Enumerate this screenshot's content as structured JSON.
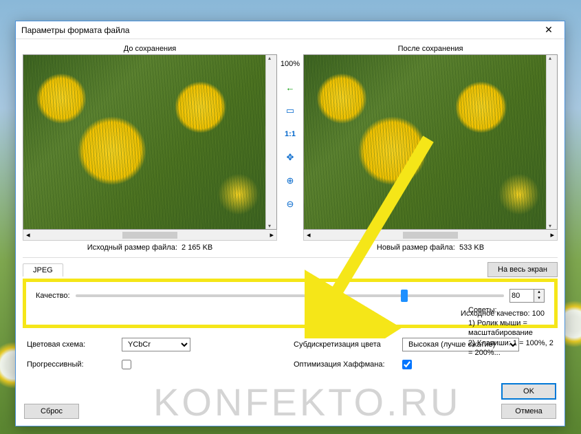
{
  "window": {
    "title": "Параметры формата файла"
  },
  "preview": {
    "before_label": "До сохранения",
    "after_label": "После сохранения",
    "zoom": "100%",
    "orig_size_label": "Исходный размер файла:",
    "orig_size_value": "2 165 KB",
    "new_size_label": "Новый размер файла:",
    "new_size_value": "533 KB"
  },
  "toolbar_icons": {
    "back": "←",
    "fit": "▭",
    "one_to_one": "1:1",
    "move": "✥",
    "zoom_in": "⊕",
    "zoom_out": "⊖"
  },
  "tabs": {
    "jpeg": "JPEG"
  },
  "buttons": {
    "fullscreen": "На весь экран",
    "ok": "OK",
    "cancel": "Отмена",
    "reset": "Сброс"
  },
  "quality": {
    "label": "Качество:",
    "value": "80",
    "original_label": "Исходное качество:",
    "original_value": "100"
  },
  "options": {
    "color_scheme_label": "Цветовая схема:",
    "color_scheme_value": "YCbCr",
    "subsampling_label": "Субдискретизация цвета",
    "subsampling_value": "Высокая (лучше сжатие)",
    "progressive_label": "Прогрессивный:",
    "progressive_checked": false,
    "huffman_label": "Оптимизация Хаффмана:",
    "huffman_checked": true
  },
  "tips": {
    "title": "Советы:",
    "body": "1) Ролик мыши = масштабирование\n2) Клавиши: 1 = 100%, 2 = 200%..."
  },
  "watermark": "KONFEKTO.RU"
}
